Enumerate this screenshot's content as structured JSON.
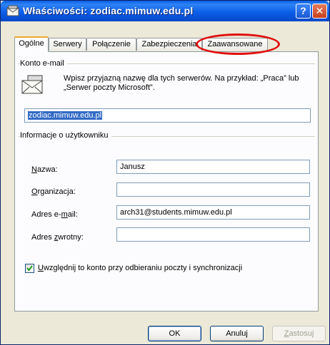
{
  "window": {
    "title": "Właściwości: zodiac.mimuw.edu.pl",
    "help_glyph": "?",
    "close_glyph": "✕"
  },
  "tabs": [
    {
      "label": "Ogólne",
      "active": true
    },
    {
      "label": "Serwery",
      "active": false
    },
    {
      "label": "Połączenie",
      "active": false
    },
    {
      "label": "Zabezpieczenia",
      "active": false
    },
    {
      "label": "Zaawansowane",
      "active": false
    }
  ],
  "account": {
    "group_label": "Konto e-mail",
    "description": "Wpisz przyjazną nazwę dla tych serwerów. Na przykład: „Praca” lub „Serwer poczty Microsoft”.",
    "name_value": "zodiac.mimuw.edu.pl",
    "icon": "mail-account-icon"
  },
  "user_info": {
    "group_label": "Informacje o użytkowniku",
    "fields": {
      "name": {
        "label_u": "N",
        "label_rest": "azwa:",
        "value": "Janusz"
      },
      "organization": {
        "label_u": "O",
        "label_rest": "rganizacja:",
        "value": ""
      },
      "email": {
        "label_pre": "Adres e-",
        "label_u": "m",
        "label_rest": "ail:",
        "value": "arch31@students.mimuw.edu.pl"
      },
      "reply": {
        "label_pre": "Adres ",
        "label_u": "z",
        "label_rest": "wrotny:",
        "value": ""
      }
    }
  },
  "include_account": {
    "checked": true,
    "label_u": "U",
    "label_rest": "względnij to konto przy odbieraniu poczty i synchronizacji"
  },
  "buttons": {
    "ok": "OK",
    "cancel": "Anuluj",
    "apply_u": "Z",
    "apply_rest": "astosuj"
  },
  "colors": {
    "titlebar": "#0b5fe8",
    "annotation": "#e01010",
    "active_tab_accent": "#f0a82c",
    "selection": "#316ac5"
  }
}
